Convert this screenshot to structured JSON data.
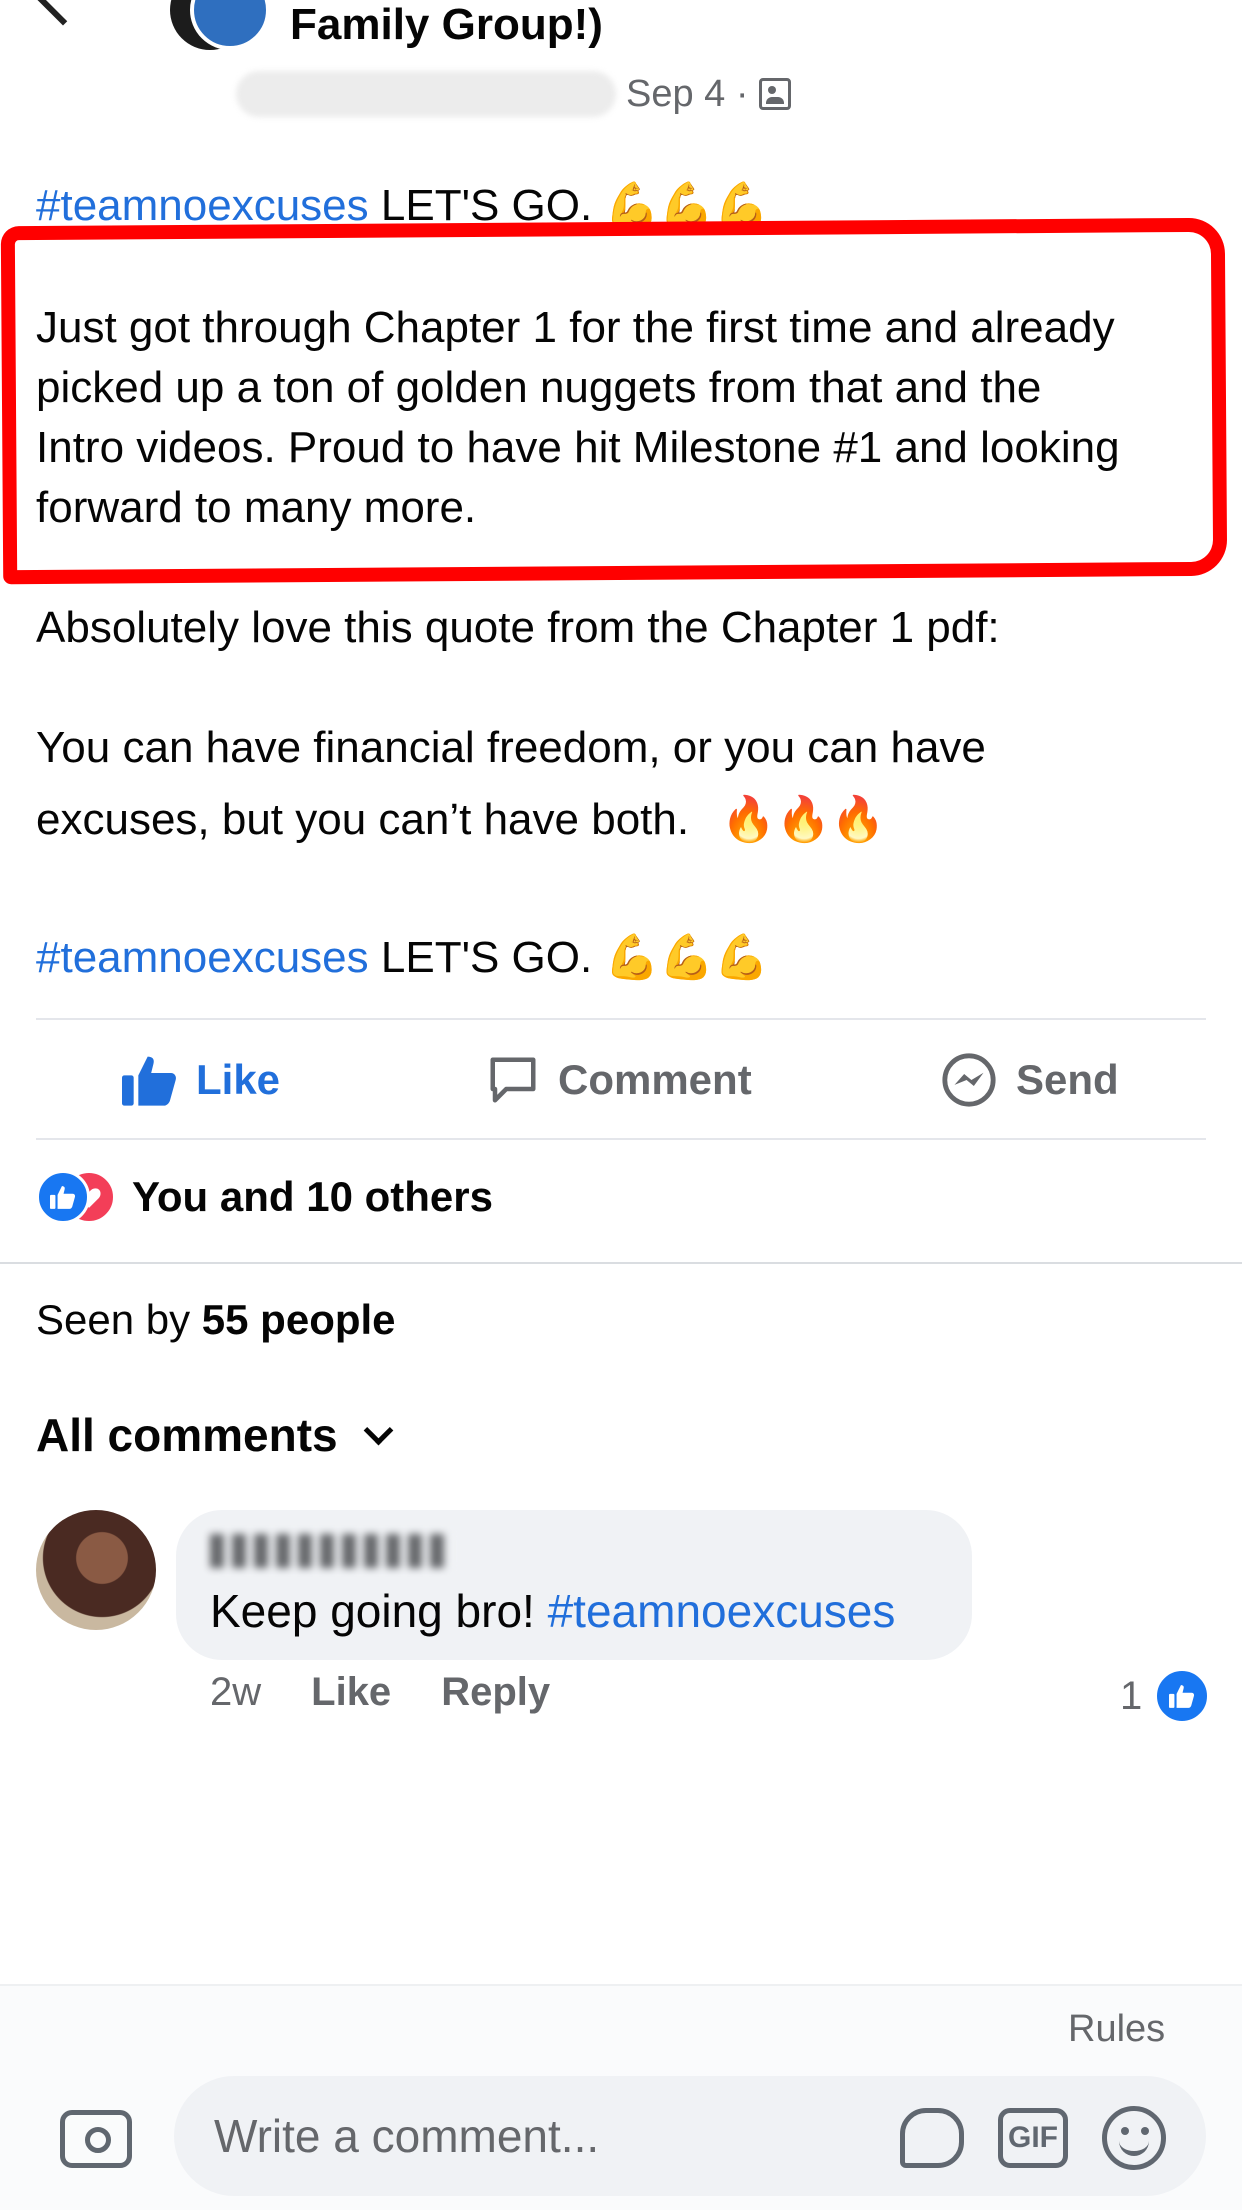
{
  "header": {
    "group_title": "Family Group!)",
    "post_date": "Sep 4 ·",
    "audience_icon": "group-audience-icon"
  },
  "post": {
    "hashtag": "#teamnoexcuses",
    "lets_go": "LET'S GO.",
    "flex_emojis": "💪💪💪",
    "highlighted_lines": [
      "Just got through Chapter 1 for the first time and already",
      "picked up a ton of golden nuggets from that and the",
      "Intro videos. Proud to have hit Milestone #1 and looking",
      "forward to many more."
    ],
    "quote_intro": "Absolutely love this quote from the Chapter 1 pdf:",
    "quote_line1": "You can have financial freedom, or you can have",
    "quote_line2": "excuses, but you can’t have both.",
    "fire_emojis": "🔥🔥🔥",
    "highlight_color": "#ff0000"
  },
  "actions": {
    "like": "Like",
    "comment": "Comment",
    "send": "Send",
    "like_color": "#216fdb"
  },
  "reactions": {
    "text": "You and 10 others",
    "icons": [
      "like-reaction-icon",
      "love-reaction-icon"
    ]
  },
  "seen": {
    "prefix": "Seen by",
    "count": "55 people"
  },
  "comments": {
    "header": "All comments",
    "items": [
      {
        "text_plain": "Keep going bro!",
        "hashtag": "#teamnoexcuses",
        "time": "2w",
        "like_label": "Like",
        "reply_label": "Reply",
        "like_count": "1"
      }
    ]
  },
  "composer": {
    "rules": "Rules",
    "placeholder": "Write a comment...",
    "gif_label": "GIF"
  }
}
